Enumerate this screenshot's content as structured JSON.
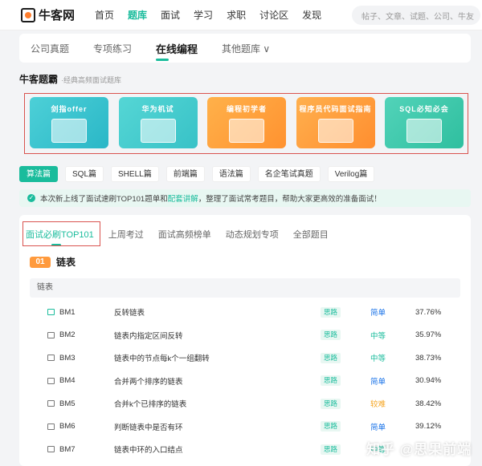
{
  "header": {
    "logo_text": "牛客网",
    "nav": [
      "首页",
      "题库",
      "面试",
      "学习",
      "求职",
      "讨论区",
      "发现"
    ],
    "active_nav": "题库",
    "search_placeholder": "帖子、文章、试题、公司、牛友"
  },
  "tabs": [
    {
      "label": "公司真题",
      "active": false
    },
    {
      "label": "专项练习",
      "active": false
    },
    {
      "label": "在线编程",
      "active": true
    },
    {
      "label": "其他题库 ∨",
      "active": false
    }
  ],
  "section": {
    "title": "牛客题霸",
    "subtitle": "·经典高频面试题库"
  },
  "banners": [
    {
      "title": "剑指offer",
      "icon": "book-stack-icon"
    },
    {
      "title": "华为机试",
      "icon": "laptop-icon"
    },
    {
      "title": "编程初学者",
      "icon": "code-icon"
    },
    {
      "title": "程序员代码面试指南",
      "icon": "book-icon"
    },
    {
      "title": "SQL必知必会",
      "icon": "database-icon"
    }
  ],
  "pills": [
    {
      "label": "算法篇",
      "active": true
    },
    {
      "label": "SQL篇",
      "active": false
    },
    {
      "label": "SHELL篇",
      "active": false
    },
    {
      "label": "前端篇",
      "active": false
    },
    {
      "label": "语法篇",
      "active": false
    },
    {
      "label": "名企笔试真题",
      "active": false
    },
    {
      "label": "Verilog篇",
      "active": false
    }
  ],
  "notice": {
    "text_before": "本次新上线了面试速刷TOP101题单和",
    "link": "配套讲解",
    "text_after": "，整理了面试常考题目，帮助大家更高效的准备面试！"
  },
  "subtabs": [
    {
      "label": "面试必刷TOP101",
      "active": true
    },
    {
      "label": "上周考过",
      "active": false
    },
    {
      "label": "面试高频榜单",
      "active": false
    },
    {
      "label": "动态规划专项",
      "active": false
    },
    {
      "label": "全部题目",
      "active": false
    }
  ],
  "chapter": {
    "num": "01",
    "title": "链表"
  },
  "group_head": "链表",
  "colors": {
    "accent": "#1abc9c",
    "easy": "#1a73e8",
    "medium": "#1abc9c",
    "hard": "#f5a623"
  },
  "rows": [
    {
      "id": "BM1",
      "name": "反转链表",
      "tag": "思路",
      "difficulty": "简单",
      "level": "easy",
      "rate": "37.76%",
      "done": true
    },
    {
      "id": "BM2",
      "name": "链表内指定区间反转",
      "tag": "思路",
      "difficulty": "中等",
      "level": "medium",
      "rate": "35.97%",
      "done": false
    },
    {
      "id": "BM3",
      "name": "链表中的节点每k个一组翻转",
      "tag": "思路",
      "difficulty": "中等",
      "level": "medium",
      "rate": "38.73%",
      "done": false
    },
    {
      "id": "BM4",
      "name": "合并两个排序的链表",
      "tag": "思路",
      "difficulty": "简单",
      "level": "easy",
      "rate": "30.94%",
      "done": false
    },
    {
      "id": "BM5",
      "name": "合并k个已排序的链表",
      "tag": "思路",
      "difficulty": "较难",
      "level": "hard",
      "rate": "38.42%",
      "done": false
    },
    {
      "id": "BM6",
      "name": "判断链表中是否有环",
      "tag": "思路",
      "difficulty": "简单",
      "level": "easy",
      "rate": "39.12%",
      "done": false
    },
    {
      "id": "BM7",
      "name": "链表中环的入口结点",
      "tag": "思路",
      "difficulty": "中等",
      "level": "medium",
      "rate": "",
      "done": false
    }
  ],
  "watermark": "知乎 @思果前端"
}
